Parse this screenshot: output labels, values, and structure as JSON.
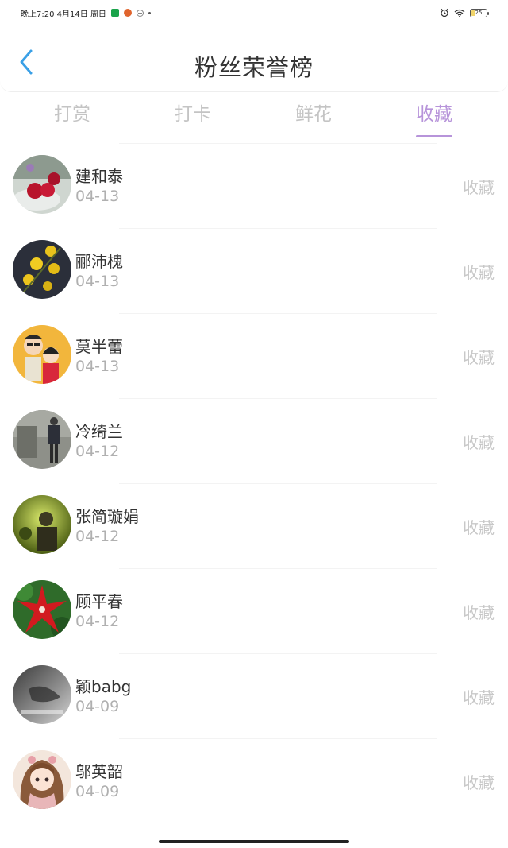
{
  "status_bar": {
    "time_text": "晚上7:20 4月14日 周日",
    "battery_level": "25",
    "battery_fraction": 0.25,
    "icons": [
      "app-icon",
      "pumpkin-icon",
      "do-not-disturb-icon",
      "dot-icon",
      "alarm-icon",
      "wifi-icon",
      "battery-icon"
    ]
  },
  "header": {
    "title": "粉丝荣誉榜",
    "back_icon": "chevron-left-icon"
  },
  "tabs": [
    {
      "label": "打赏",
      "active": false
    },
    {
      "label": "打卡",
      "active": false
    },
    {
      "label": "鲜花",
      "active": false
    },
    {
      "label": "收藏",
      "active": true
    }
  ],
  "colors": {
    "accent": "#b794da",
    "back_arrow": "#3aa0e6",
    "muted_text": "#c8c8c8"
  },
  "list": [
    {
      "name": "建和泰",
      "date": "04-13",
      "action": "收藏"
    },
    {
      "name": "郦沛槐",
      "date": "04-13",
      "action": "收藏"
    },
    {
      "name": "莫半蕾",
      "date": "04-13",
      "action": "收藏"
    },
    {
      "name": "冷绮兰",
      "date": "04-12",
      "action": "收藏"
    },
    {
      "name": "张简璇娟",
      "date": "04-12",
      "action": "收藏"
    },
    {
      "name": "顾平春",
      "date": "04-12",
      "action": "收藏"
    },
    {
      "name": "颖babg",
      "date": "04-09",
      "action": "收藏"
    },
    {
      "name": "邬英韶",
      "date": "04-09",
      "action": "收藏"
    }
  ]
}
